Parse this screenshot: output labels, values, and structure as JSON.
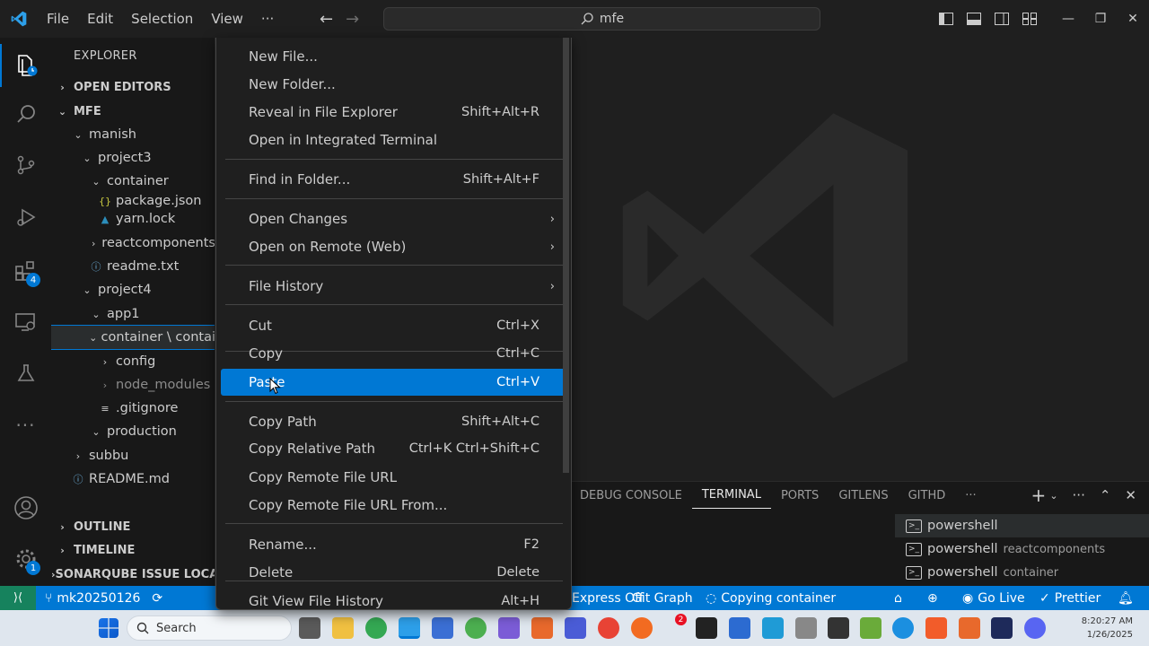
{
  "titlebar": {
    "menu": [
      "File",
      "Edit",
      "Selection",
      "View",
      "···"
    ],
    "search_text": "mfe"
  },
  "activity": {
    "extensions_badge": "4",
    "manage_badge": "1"
  },
  "sidebar": {
    "title": "EXPLORER",
    "open_editors": "OPEN EDITORS",
    "root": "MFE",
    "tree": [
      {
        "label": "manish",
        "chev": "⌄",
        "indent": 1
      },
      {
        "label": "project3",
        "chev": "⌄",
        "indent": 2
      },
      {
        "label": "container",
        "chev": "⌄",
        "indent": 3
      },
      {
        "label": "package.json",
        "chev": "",
        "indent": 4
      },
      {
        "label": "yarn.lock",
        "chev": "",
        "indent": 4
      },
      {
        "label": "reactcomponents",
        "chev": "›",
        "indent": 3
      },
      {
        "label": "readme.txt",
        "chev": "",
        "indent": 3
      },
      {
        "label": "project4",
        "chev": "⌄",
        "indent": 2
      },
      {
        "label": "app1",
        "chev": "⌄",
        "indent": 3
      },
      {
        "label": "container \\ contai",
        "chev": "⌄",
        "indent": 3
      },
      {
        "label": "config",
        "chev": "›",
        "indent": 4
      },
      {
        "label": "node_modules",
        "chev": "›",
        "indent": 4
      },
      {
        "label": ".gitignore",
        "chev": "",
        "indent": 4
      },
      {
        "label": "production",
        "chev": "⌄",
        "indent": 3
      },
      {
        "label": "subbu",
        "chev": "›",
        "indent": 1
      },
      {
        "label": "README.md",
        "chev": "",
        "indent": 1
      }
    ],
    "outline": "OUTLINE",
    "timeline": "TIMELINE",
    "sonarqube": "SONARQUBE ISSUE LOCATIONS"
  },
  "context_menu": {
    "items": [
      {
        "label": "New File...",
        "kb": ""
      },
      {
        "label": "New Folder...",
        "kb": ""
      },
      {
        "label": "Reveal in File Explorer",
        "kb": "Shift+Alt+R"
      },
      {
        "label": "Open in Integrated Terminal",
        "kb": ""
      },
      {
        "label": "Find in Folder...",
        "kb": "Shift+Alt+F"
      },
      {
        "label": "Open Changes",
        "kb": ""
      },
      {
        "label": "Open on Remote (Web)",
        "kb": ""
      },
      {
        "label": "File History",
        "kb": ""
      },
      {
        "label": "Cut",
        "kb": "Ctrl+X"
      },
      {
        "label": "Copy",
        "kb": "Ctrl+C"
      },
      {
        "label": "Paste",
        "kb": "Ctrl+V"
      },
      {
        "label": "Copy Path",
        "kb": "Shift+Alt+C"
      },
      {
        "label": "Copy Relative Path",
        "kb": "Ctrl+K Ctrl+Shift+C"
      },
      {
        "label": "Copy Remote File URL",
        "kb": ""
      },
      {
        "label": "Copy Remote File URL From...",
        "kb": ""
      },
      {
        "label": "Rename...",
        "kb": "F2"
      },
      {
        "label": "Delete",
        "kb": "Delete"
      },
      {
        "label": "Git View File History",
        "kb": "Alt+H"
      }
    ]
  },
  "panel": {
    "tabs": [
      "DEBUG CONSOLE",
      "TERMINAL",
      "PORTS",
      "GITLENS",
      "GITHD",
      "···"
    ],
    "terminals": [
      {
        "name": "powershell",
        "sub": ""
      },
      {
        "name": "powershell",
        "sub": "reactcomponents"
      },
      {
        "name": "powershell",
        "sub": "container"
      }
    ]
  },
  "statusbar": {
    "branch": "mk20250126",
    "express": "Express Off",
    "git_graph": "Git Graph",
    "progress": "Copying container",
    "go_live": "Go Live",
    "prettier": "Prettier"
  },
  "taskbar": {
    "search_placeholder": "Search",
    "time": "8:20:27 AM",
    "date": "1/26/2025",
    "notification_count": "2"
  },
  "colors": {
    "accent": "#0078d4",
    "remote": "#16825d",
    "background": "#1f1f1f"
  }
}
